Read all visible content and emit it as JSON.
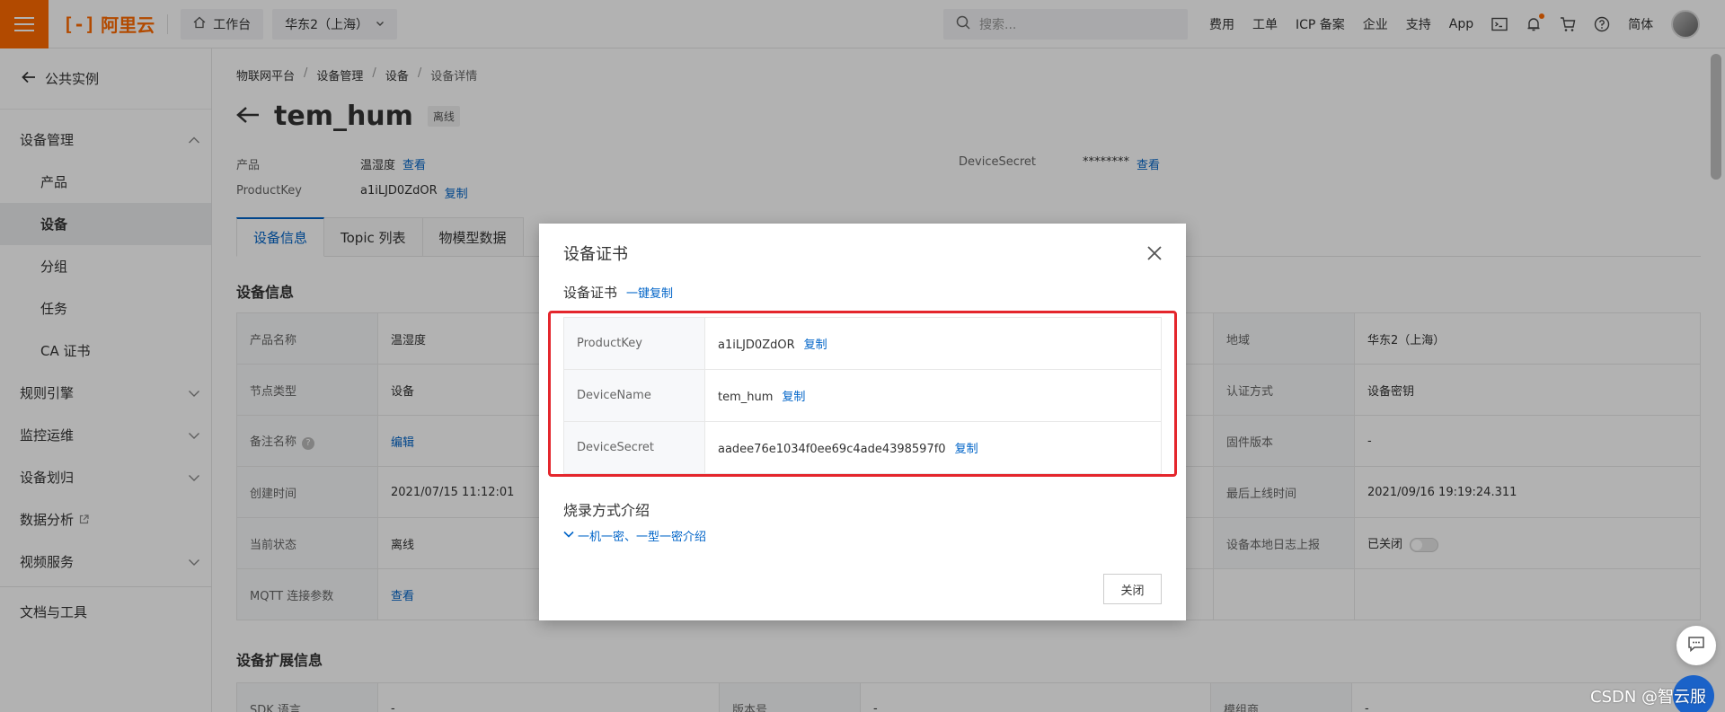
{
  "topbar": {
    "brand": "阿里云",
    "workbench": "工作台",
    "region": "华东2（上海）",
    "search_placeholder": "搜索...",
    "links": [
      "费用",
      "工单",
      "ICP 备案",
      "企业",
      "支持",
      "App"
    ],
    "lang": "简体"
  },
  "sidebar": {
    "back_label": "公共实例",
    "device_mgmt": "设备管理",
    "items": [
      "产品",
      "设备",
      "分组",
      "任务",
      "CA 证书"
    ],
    "groups": [
      "规则引擎",
      "监控运维",
      "设备划归",
      "数据分析",
      "视频服务"
    ],
    "docs": "文档与工具"
  },
  "main": {
    "breadcrumb": [
      "物联网平台",
      "设备管理",
      "设备",
      "设备详情"
    ],
    "title": "tem_hum",
    "status_badge": "离线",
    "meta": {
      "product_label": "产品",
      "product_value": "温湿度",
      "view_label": "查看",
      "productkey_label": "ProductKey",
      "productkey_value": "a1iLJD0ZdOR",
      "copy_label": "复制",
      "secret_label": "DeviceSecret",
      "secret_value": "********",
      "secret_view": "查看"
    },
    "tabs": [
      "设备信息",
      "Topic 列表",
      "物模型数据"
    ],
    "section_info": "设备信息",
    "info_rows": [
      {
        "k1": "产品名称",
        "v1": "温湿度",
        "k3": "地域",
        "v3": "华东2（上海）"
      },
      {
        "k1": "节点类型",
        "v1": "设备",
        "k3": "认证方式",
        "v3": "设备密钥"
      },
      {
        "k1": "备注名称",
        "v1": "编辑",
        "k3": "固件版本",
        "v3": "-"
      },
      {
        "k1": "创建时间",
        "v1": "2021/07/15 11:12:01",
        "k3": "最后上线时间",
        "v3": "2021/09/16 19:19:24.311"
      },
      {
        "k1": "当前状态",
        "v1": "离线",
        "k3": "设备本地日志上报",
        "v3": "已关闭"
      },
      {
        "k1": "MQTT 连接参数",
        "v1": "查看",
        "k3": "",
        "v3": ""
      }
    ],
    "section_ext": "设备扩展信息",
    "ext_row": {
      "k1": "SDK 语言",
      "v1": "-",
      "k2": "版本号",
      "v2": "-",
      "k3": "模组商",
      "v3": "-"
    }
  },
  "modal": {
    "title": "设备证书",
    "subtitle": "设备证书",
    "copy_all": "一键复制",
    "rows": [
      {
        "key": "ProductKey",
        "value": "a1iLJD0ZdOR",
        "copy": "复制"
      },
      {
        "key": "DeviceName",
        "value": "tem_hum",
        "copy": "复制"
      },
      {
        "key": "DeviceSecret",
        "value": "aadee76e1034f0ee69c4ade4398597f0",
        "copy": "复制"
      }
    ],
    "burn_title": "烧录方式介绍",
    "burn_link": "一机一密、一型一密介绍",
    "close_label": "关闭"
  },
  "watermark": "CSDN @智云服",
  "colors": {
    "brand": "#ff6a00",
    "link": "#0064c8",
    "highlight": "#e4262c"
  }
}
